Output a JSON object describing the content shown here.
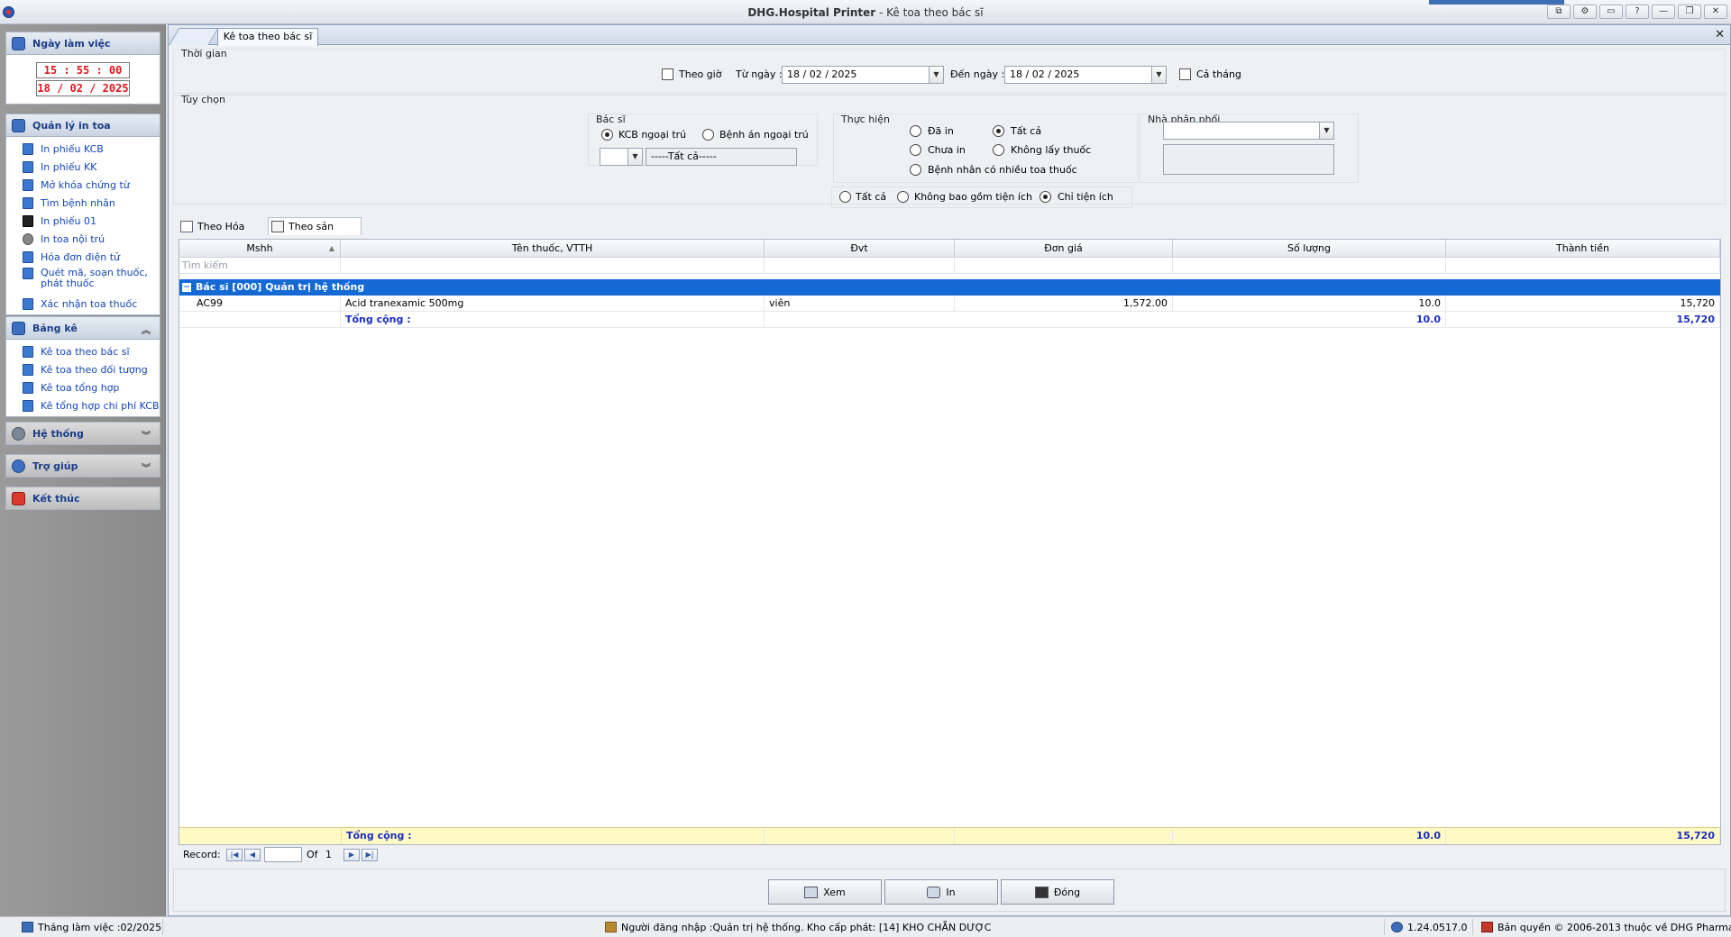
{
  "window": {
    "title_bold": "DHG.Hospital Printer",
    "title_sep": " - ",
    "title_rest": "Kê toa theo bác sĩ",
    "buttons": [
      "⧉",
      "⚙",
      "▭",
      "?",
      "—",
      "❐",
      "✕"
    ]
  },
  "sidebar": {
    "workday": {
      "title": "Ngày làm việc",
      "time": "15 : 55 : 00",
      "date": "18 / 02 / 2025"
    },
    "print_mgmt": {
      "title": "Quản lý in toa",
      "items": [
        "In phiếu KCB",
        "In phiếu KK",
        "Mở khóa chứng từ",
        "Tìm bệnh nhân",
        "In phiếu 01",
        "In toa nội trú",
        "Hóa đơn điện tử",
        "Quét mã, soạn thuốc, phát thuốc",
        "Xác nhận toa thuốc"
      ]
    },
    "reports": {
      "title": "Bảng kê",
      "items": [
        "Kê toa theo bác sĩ",
        "Kê toa theo đối tượng",
        "Kê toa tổng hợp",
        "Kê tổng hợp chi phí KCB"
      ]
    },
    "system": {
      "title": "Hệ thống"
    },
    "help": {
      "title": "Trợ giúp"
    },
    "exit": {
      "title": "Kết thúc"
    }
  },
  "main": {
    "tab_label": "Kê toa theo bác sĩ",
    "time_group": {
      "label": "Thời gian",
      "by_hour": "Theo giờ",
      "from_label": "Từ ngày :",
      "from_value": "18 / 02 / 2025",
      "to_label": "Đến ngày :",
      "to_value": "18 / 02 / 2025",
      "whole_month": "Cả tháng"
    },
    "options_group": {
      "label": "Tùy chọn",
      "doctor": {
        "label": "Bác sĩ",
        "opt_outpatient": "KCB ngoại trú",
        "opt_record": "Bệnh án ngoại trú",
        "all_value": "-----Tất cả-----"
      },
      "execution": {
        "label": "Thực hiện",
        "printed": "Đã in",
        "all": "Tất cả",
        "not_printed": "Chưa in",
        "no_take": "Không lấy thuốc",
        "multi": "Bệnh nhân có nhiều toa thuốc"
      },
      "distributor": {
        "label": "Nhà phân phối"
      },
      "utility": {
        "all": "Tất cả",
        "exclude": "Không bao gồm tiện ích",
        "only": "Chỉ tiện ích"
      }
    },
    "view_tabs": [
      "Theo Hóa đơn",
      "Theo sản phẩm"
    ],
    "grid": {
      "columns": [
        "Mshh",
        "Tên thuốc, VTTH",
        "Đvt",
        "Đơn giá",
        "Số lượng",
        "Thành tiền"
      ],
      "search_placeholder": "Tìm kiếm",
      "group_header": "Bác sĩ  [000] Quản trị hệ thống",
      "rows": [
        {
          "mshh": "AC99",
          "name": "Acid tranexamic 500mg",
          "unit": "viên",
          "price": "1,572.00",
          "qty": "10.0",
          "total": "15,720"
        }
      ],
      "group_total_label": "Tổng cộng :",
      "group_total_qty": "10.0",
      "group_total_amount": "15,720",
      "footer_label": "Tổng cộng :",
      "footer_qty": "10.0",
      "footer_amount": "15,720"
    },
    "pager": {
      "label": "Record:",
      "of": "Of",
      "total": "1"
    },
    "buttons": {
      "view": "Xem",
      "print": "In",
      "close": "Đóng"
    }
  },
  "status": {
    "work_month": "Tháng làm việc :02/2025",
    "login": "Người đăng nhập :Quản trị hệ thống. Kho cấp phát: [14] KHO CHẴN DƯỢC",
    "version": "1.24.0517.0",
    "copyright": "Bản quyền © 2006-2013 thuộc về DHG Pharma"
  }
}
